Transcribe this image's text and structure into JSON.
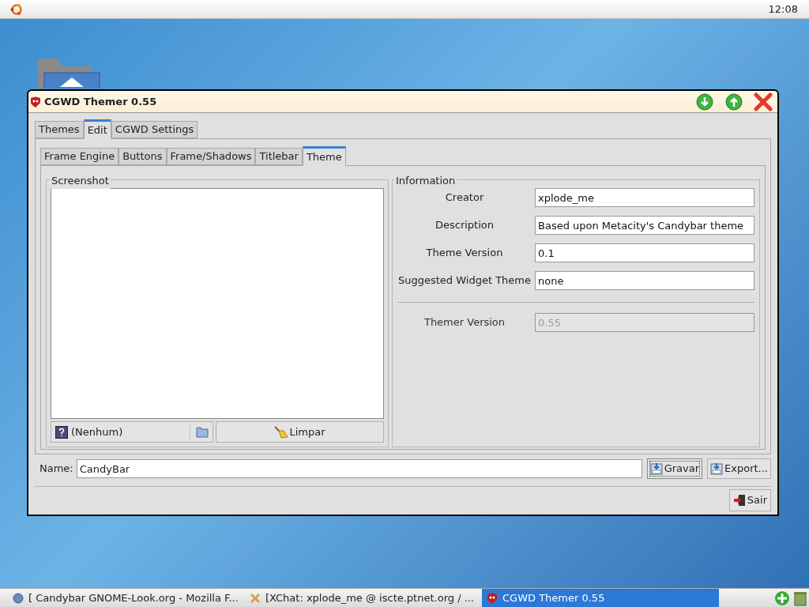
{
  "top_panel": {
    "clock": "12:08"
  },
  "window": {
    "title": "CGWD Themer 0.55",
    "tabs": [
      {
        "label": "Themes",
        "selected": false
      },
      {
        "label": "Edit",
        "selected": true
      },
      {
        "label": "CGWD Settings",
        "selected": false
      }
    ],
    "subtabs": [
      {
        "label": "Frame Engine",
        "selected": false
      },
      {
        "label": "Buttons",
        "selected": false
      },
      {
        "label": "Frame/Shadows",
        "selected": false
      },
      {
        "label": "Titlebar",
        "selected": false
      },
      {
        "label": "Theme",
        "selected": true
      }
    ],
    "screenshot": {
      "title": "Screenshot",
      "file_chooser": "(Nenhum)",
      "clear_button": "Limpar"
    },
    "information": {
      "title": "Information",
      "fields": [
        {
          "label": "Creator",
          "value": "xplode_me",
          "disabled": false
        },
        {
          "label": "Description",
          "value": "Based upon Metacity's Candybar theme",
          "disabled": false
        },
        {
          "label": "Theme Version",
          "value": "0.1",
          "disabled": false
        },
        {
          "label": "Suggested Widget Theme",
          "value": "none",
          "disabled": false
        },
        {
          "label": "Themer Version",
          "value": "0.55",
          "disabled": true
        }
      ]
    },
    "name_label": "Name:",
    "name_value": "CandyBar",
    "buttons": [
      {
        "label": "Gravar",
        "focused": true
      },
      {
        "label": "Export...",
        "focused": false
      }
    ],
    "quit_button": "Sair"
  },
  "taskbar": [
    {
      "label": "[ Candybar GNOME-Look.org - Mozilla F...",
      "selected": false,
      "kind": "browser"
    },
    {
      "label": "[XChat: xplode_me @ iscte.ptnet.org / ...",
      "selected": false,
      "kind": "chat"
    },
    {
      "label": "CGWD Themer 0.55",
      "selected": true,
      "kind": "app"
    }
  ]
}
